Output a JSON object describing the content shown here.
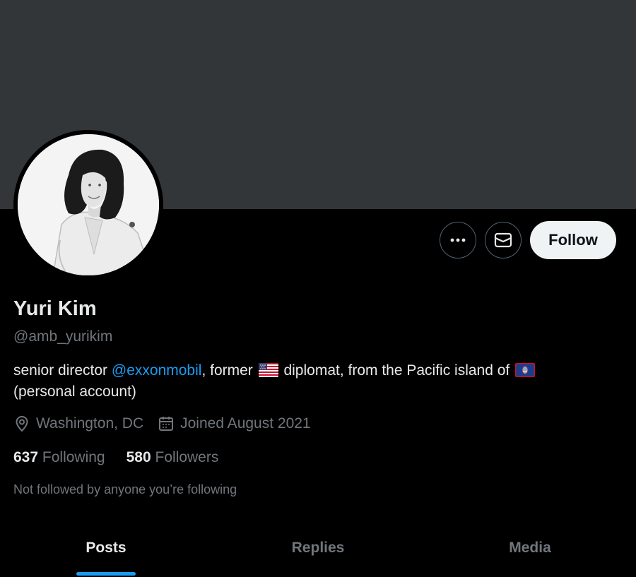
{
  "profile": {
    "name": "Yuri Kim",
    "handle": "@amb_yurikim",
    "bio": {
      "part1": "senior director ",
      "mention": "@exxonmobil",
      "part2": ", former ",
      "flag1": "us-flag-icon",
      "part3": " diplomat, from the Pacific island of ",
      "flag2": "guam-flag-icon",
      "line2": "(personal account)"
    },
    "location": "Washington, DC",
    "joined": "Joined August 2021",
    "following_count": "637",
    "following_label": "Following",
    "followers_count": "580",
    "followers_label": "Followers",
    "not_followed": "Not followed by anyone you’re following"
  },
  "actions": {
    "more_icon": "more-icon",
    "message_icon": "envelope-icon",
    "follow_label": "Follow"
  },
  "tabs": [
    {
      "label": "Posts",
      "active": true
    },
    {
      "label": "Replies",
      "active": false
    },
    {
      "label": "Media",
      "active": false
    }
  ],
  "colors": {
    "banner": "#333639",
    "accent": "#1d9bf0",
    "background": "#000000",
    "secondary_text": "#71767b"
  }
}
